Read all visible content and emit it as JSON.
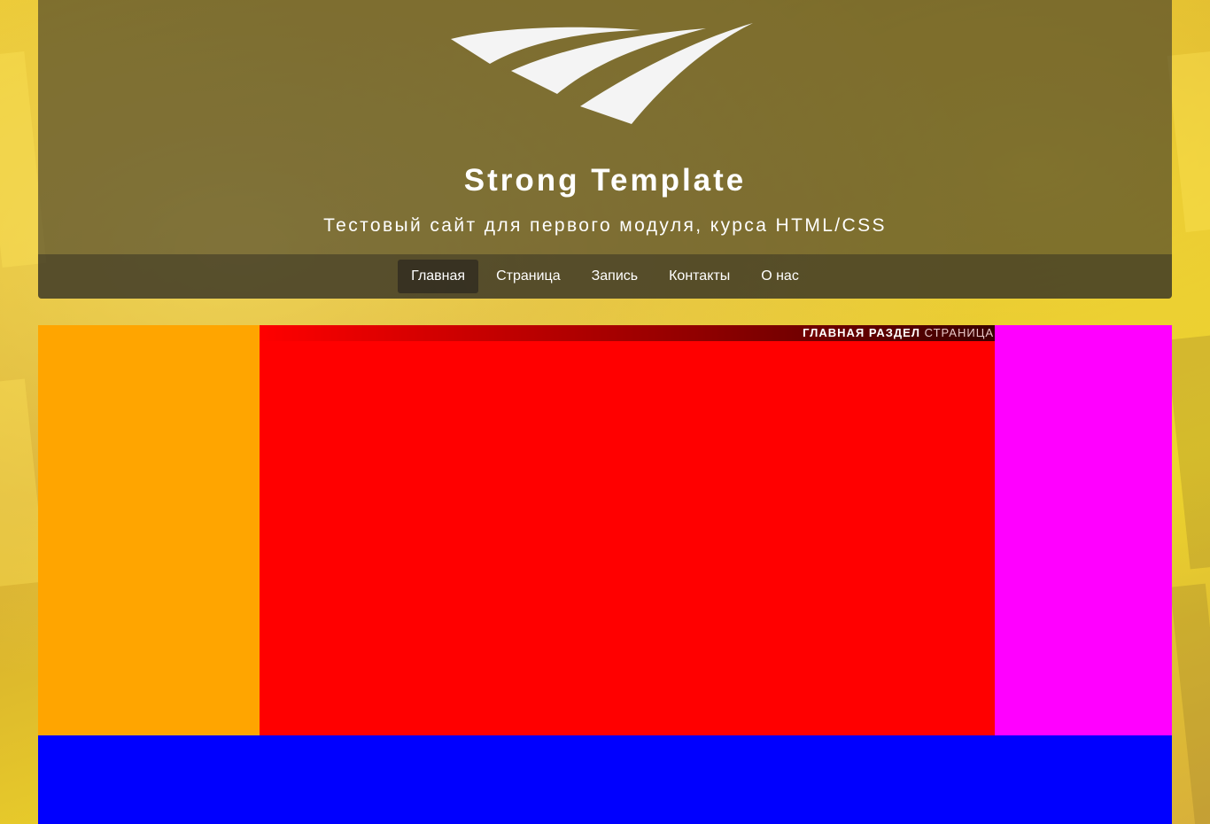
{
  "header": {
    "site_title": "Strong Template",
    "site_subtitle": "Тестовый сайт для первого модуля, курса HTML/CSS",
    "logo_icon": "speed-stripes-logo"
  },
  "nav": {
    "items": [
      {
        "label": "Главная",
        "active": true
      },
      {
        "label": "Страница",
        "active": false
      },
      {
        "label": "Запись",
        "active": false
      },
      {
        "label": "Контакты",
        "active": false
      },
      {
        "label": "О нас",
        "active": false
      }
    ]
  },
  "breadcrumb": {
    "items": [
      "ГЛАВНАЯ",
      "РАЗДЕЛ"
    ],
    "current": "СТРАНИЦА"
  },
  "colors": {
    "left_column": "#ffa500",
    "main_column": "#ff0000",
    "right_column": "#ff00ff",
    "footer": "#0000ff"
  }
}
